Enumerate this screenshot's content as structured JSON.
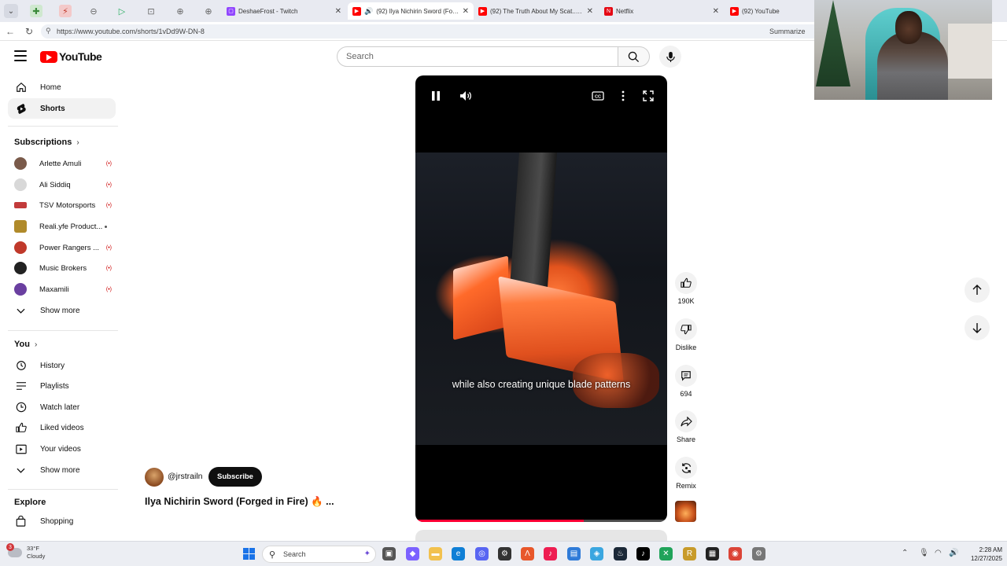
{
  "browser": {
    "tabs": [
      {
        "title": "DeshaeFrost - Twitch",
        "color": "#9146ff"
      },
      {
        "title": "(92) Ilya Nichirin Sword (Forge",
        "color": "#ff0000"
      },
      {
        "title": "(92) The Truth About My Scat... - Yo",
        "color": "#ff0000"
      },
      {
        "title": "Netflix",
        "color": "#e50914"
      },
      {
        "title": "(92) YouTube",
        "color": "#ff0000"
      }
    ],
    "url": "https://www.youtube.com/shorts/1vDd9W-DN-8",
    "summarize_label": "Summarize"
  },
  "header": {
    "logo_text": "YouTube",
    "search_placeholder": "Search"
  },
  "sidebar": {
    "main": [
      {
        "label": "Home"
      },
      {
        "label": "Shorts"
      }
    ],
    "subscriptions_title": "Subscriptions",
    "subscriptions": [
      {
        "name": "Arlette Amuli",
        "status": "(•)",
        "color": "#7a5a4a"
      },
      {
        "name": "Ali Siddiq",
        "status": "(•)",
        "color": "#d8d8d8"
      },
      {
        "name": "TSV Motorsports",
        "status": "(•)",
        "color": "#c23b3b"
      },
      {
        "name": "Reali.yfe Product...",
        "status": "•",
        "color": "#b08a2a"
      },
      {
        "name": "Power Rangers ...",
        "status": "(•)",
        "color": "#c0392b"
      },
      {
        "name": "Music Brokers",
        "status": "(•)",
        "color": "#222222"
      },
      {
        "name": "Maxamili",
        "status": "(•)",
        "color": "#6a3fa0"
      }
    ],
    "subs_show_more": "Show more",
    "you_title": "You",
    "you_items": [
      {
        "label": "History"
      },
      {
        "label": "Playlists"
      },
      {
        "label": "Watch later"
      },
      {
        "label": "Liked videos"
      },
      {
        "label": "Your videos"
      }
    ],
    "you_show_more": "Show more",
    "explore_title": "Explore",
    "explore_items": [
      {
        "label": "Shopping"
      }
    ]
  },
  "player": {
    "caption": "while also creating unique blade patterns",
    "progress": 0.67
  },
  "actions": {
    "likes": "190K",
    "dislike": "Dislike",
    "comments": "694",
    "share": "Share",
    "remix": "Remix"
  },
  "video": {
    "channel": "@jrstrailn",
    "subscribe": "Subscribe",
    "title": "Ilya Nichirin Sword (Forged in Fire) 🔥  ..."
  },
  "taskbar": {
    "weather_temp": "33°F",
    "weather_desc": "Cloudy",
    "weather_badge": "3",
    "search_label": "Search",
    "time": "2:28 AM",
    "date": "12/27/2025"
  }
}
